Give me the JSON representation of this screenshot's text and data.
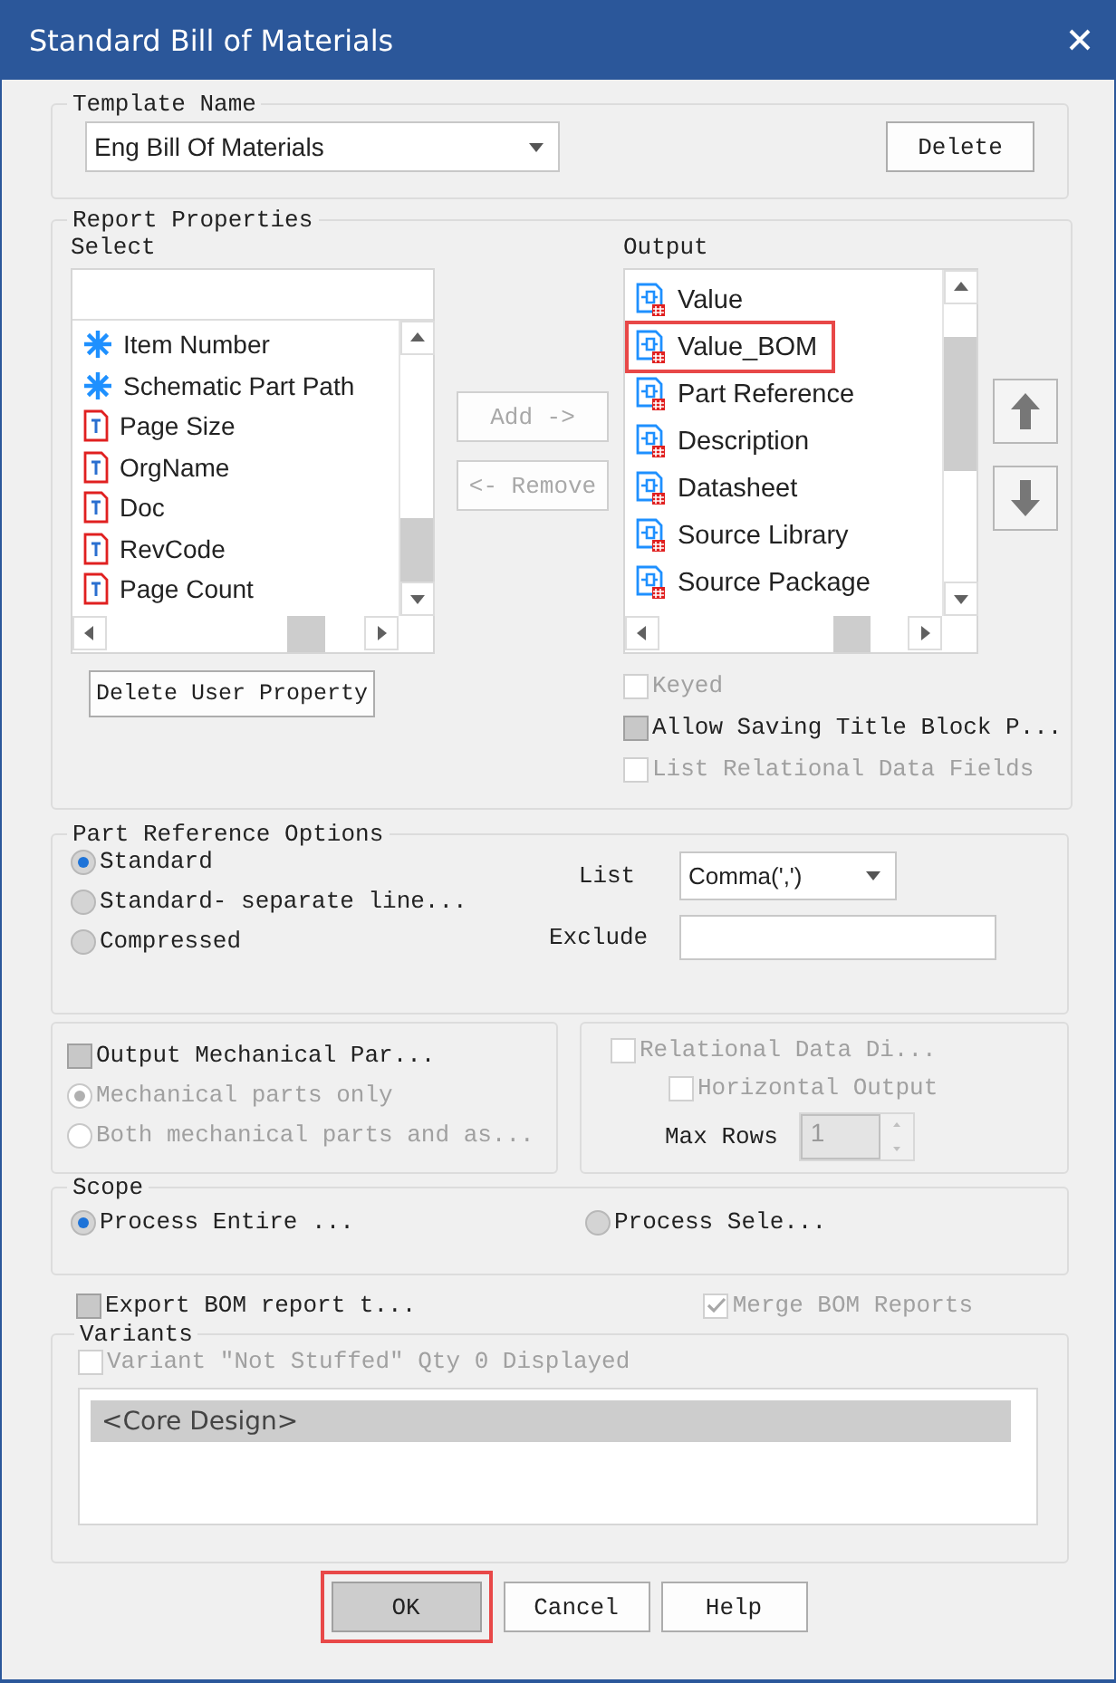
{
  "window": {
    "title": "Standard Bill of Materials"
  },
  "template": {
    "legend": "Template Name",
    "value": "Eng Bill Of Materials",
    "delete": "Delete"
  },
  "report": {
    "legend": "Report Properties",
    "select_label": "Select",
    "select_items": [
      {
        "label": "Item Number",
        "kind": "builtin"
      },
      {
        "label": "Schematic Part Path",
        "kind": "builtin"
      },
      {
        "label": "Page Size",
        "kind": "user"
      },
      {
        "label": "OrgName",
        "kind": "user"
      },
      {
        "label": "Doc",
        "kind": "user"
      },
      {
        "label": "RevCode",
        "kind": "user"
      },
      {
        "label": "Page Count",
        "kind": "user"
      }
    ],
    "add": {
      "label": "Add ->",
      "disabled": true
    },
    "remove": {
      "label": "<- Remove",
      "disabled": true
    },
    "output_label": "Output",
    "output_items": [
      {
        "label": "Value",
        "highlighted": false
      },
      {
        "label": "Value_BOM",
        "highlighted": true
      },
      {
        "label": "Part Reference",
        "highlighted": false
      },
      {
        "label": "Description",
        "highlighted": false
      },
      {
        "label": "Datasheet",
        "highlighted": false
      },
      {
        "label": "Source Library",
        "highlighted": false
      },
      {
        "label": "Source Package",
        "highlighted": false
      }
    ],
    "delete_user_property": "Delete User Property",
    "options": [
      {
        "label": "Keyed",
        "checked": false,
        "indeterminate": false,
        "disabled": true
      },
      {
        "label": "Allow Saving Title Block P...",
        "checked": false,
        "indeterminate": true,
        "disabled": false
      },
      {
        "label": "List Relational Data Fields",
        "checked": false,
        "indeterminate": false,
        "disabled": true
      }
    ]
  },
  "part_reference": {
    "legend": "Part Reference Options",
    "options": [
      {
        "label": "Standard",
        "selected": true,
        "disabled": false
      },
      {
        "label": "Standard- separate line...",
        "selected": false,
        "disabled": false
      },
      {
        "label": "Compressed",
        "selected": false,
        "disabled": false
      }
    ],
    "list_label": "List",
    "list_value": "Comma(',')",
    "exclude_label": "Exclude"
  },
  "mechanical": {
    "checkbox": {
      "label": "Output Mechanical Par...",
      "checked": false,
      "indeterminate": true,
      "disabled": false
    },
    "options": [
      {
        "label": "Mechanical parts only",
        "selected": true,
        "disabled": true
      },
      {
        "label": "Both mechanical parts and as...",
        "selected": false,
        "disabled": true
      }
    ]
  },
  "relational": {
    "checkbox": {
      "label": "Relational Data Di...",
      "checked": false,
      "indeterminate": false,
      "disabled": true
    },
    "horizontal": {
      "label": "Horizontal Output",
      "checked": false,
      "indeterminate": false,
      "disabled": true
    },
    "max_rows_label": "Max Rows",
    "max_rows_value": "1",
    "max_rows_disabled": true
  },
  "scope": {
    "legend": "Scope",
    "options": [
      {
        "label": "Process Entire ...",
        "selected": true,
        "disabled": false
      },
      {
        "label": "Process Sele...",
        "selected": false,
        "disabled": false
      }
    ]
  },
  "export": {
    "label": "Export BOM report t...",
    "checked": false,
    "indeterminate": true,
    "disabled": false
  },
  "merge": {
    "label": "Merge BOM Reports",
    "checked": true,
    "indeterminate": false,
    "disabled": true
  },
  "variants": {
    "legend": "Variants",
    "checkbox": {
      "label": "Variant \"Not Stuffed\" Qty 0 Displayed",
      "checked": false,
      "indeterminate": false,
      "disabled": true
    },
    "items": [
      {
        "label": "<Core Design>",
        "selected": true
      }
    ]
  },
  "buttons": [
    {
      "label": "OK",
      "pressed": true,
      "highlighted": true
    },
    {
      "label": "Cancel",
      "pressed": false,
      "highlighted": false
    },
    {
      "label": "Help",
      "pressed": false,
      "highlighted": false
    }
  ]
}
